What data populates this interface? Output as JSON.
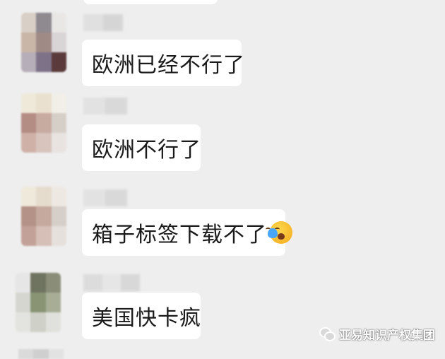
{
  "colors": {
    "background": "#eeeeee",
    "bubble": "#ffffff",
    "text": "#1a1a1a"
  },
  "messages": [
    {
      "text": "欧洲已经不行了"
    },
    {
      "text": "欧洲不行了"
    },
    {
      "text": "箱子标签下载不了",
      "emoji": "loudly-crying-face-emoji"
    },
    {
      "text": "美国快卡疯"
    }
  ],
  "watermark": {
    "icon": "wechat-icon",
    "text": "亚易知识产权集团"
  }
}
